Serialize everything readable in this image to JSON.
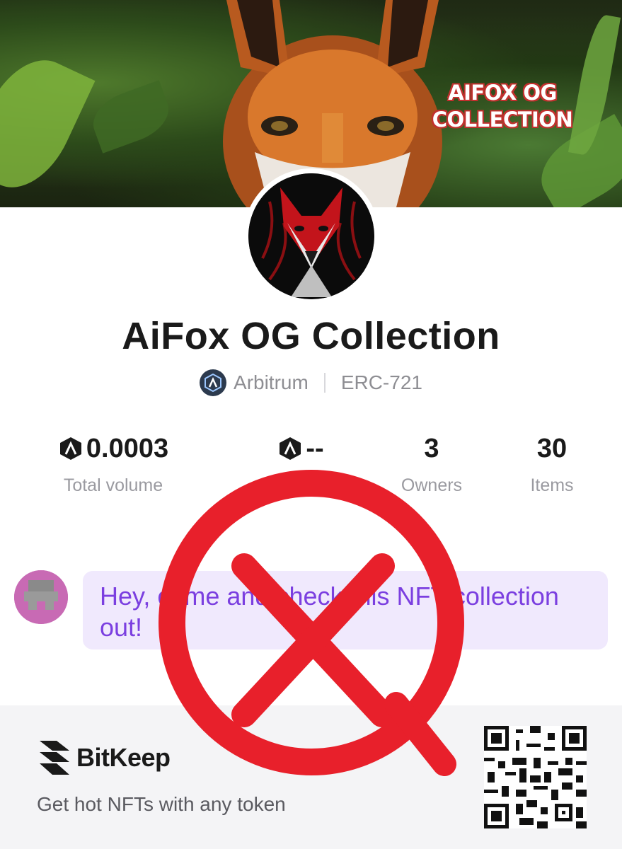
{
  "banner": {
    "text_line1": "AIFOX OG",
    "text_line2": "COLLECTION"
  },
  "collection": {
    "title": "AiFox OG Collection",
    "chain": "Arbitrum",
    "standard": "ERC-721"
  },
  "stats": [
    {
      "value": "0.0003",
      "label": "Total volume",
      "has_icon": true
    },
    {
      "value": "--",
      "label": "Floor",
      "has_icon": true
    },
    {
      "value": "3",
      "label": "Owners",
      "has_icon": false
    },
    {
      "value": "30",
      "label": "Items",
      "has_icon": false
    }
  ],
  "message": {
    "text": "Hey, come and check this NFT collection out!"
  },
  "footer": {
    "brand": "BitKeep",
    "tagline": "Get hot NFTs with any token"
  },
  "colors": {
    "overlay_red": "#e8202b",
    "message_text": "#7b3fe0",
    "message_bg": "#f0e9fd"
  },
  "icons": {
    "chain": "arbitrum-icon",
    "brand": "bitkeep-logo-icon",
    "overlay": "crossed-out-circle-icon"
  }
}
